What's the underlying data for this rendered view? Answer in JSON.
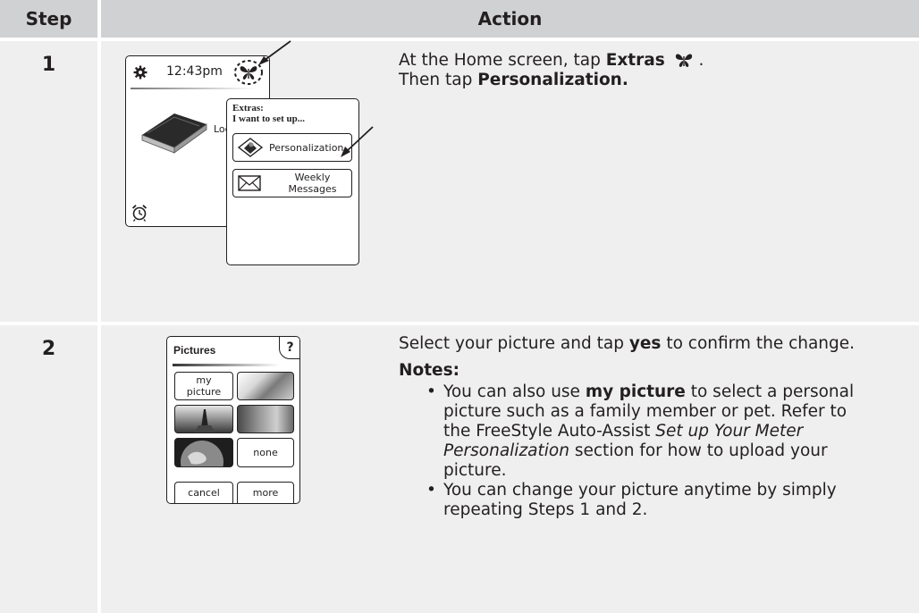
{
  "header": {
    "step": "Step",
    "action": "Action"
  },
  "rows": [
    {
      "step": "1",
      "instruction": {
        "line1_pre": "At the Home screen, tap ",
        "line1_bold": "Extras",
        "line1_post": " .",
        "line2_pre": "Then tap ",
        "line2_bold": "Personalization."
      },
      "device": {
        "time": "12:43pm",
        "logbook_label": "Logb",
        "extras_title": "Extras:",
        "extras_subtitle": "I want to set up...",
        "personalization_button": "Personalization",
        "weekly_messages_button": "Weekly Messages",
        "icons": [
          "gear-icon",
          "butterfly-icon",
          "alarm-clock-icon",
          "book-icon",
          "envelope-icon"
        ]
      }
    },
    {
      "step": "2",
      "instruction": {
        "line1_pre": "Select your picture and tap ",
        "line1_bold": "yes",
        "line1_post": " to confirm the change.",
        "notes_title": "Notes:",
        "bullet1": [
          {
            "t": "You can also use ",
            "s": "n"
          },
          {
            "t": "my picture",
            "s": "b"
          },
          {
            "t": " to select a personal picture such as a family member or pet. Refer to the FreeStyle Auto-Assist ",
            "s": "n"
          },
          {
            "t": "Set up Your Meter Personalization",
            "s": "i"
          },
          {
            "t": " section for how to upload your picture.",
            "s": "n"
          }
        ],
        "bullet2": "You can change your picture anytime by simply repeating Steps 1 and 2."
      },
      "device": {
        "title": "Pictures",
        "help_label": "?",
        "my_picture_l1": "my",
        "my_picture_l2": "picture",
        "none_button": "none",
        "cancel_button": "cancel",
        "more_button": "more"
      }
    }
  ],
  "colors": {
    "header_bg": "#d0d1d3",
    "cell_bg": "#efeff0",
    "text": "#231f20"
  }
}
